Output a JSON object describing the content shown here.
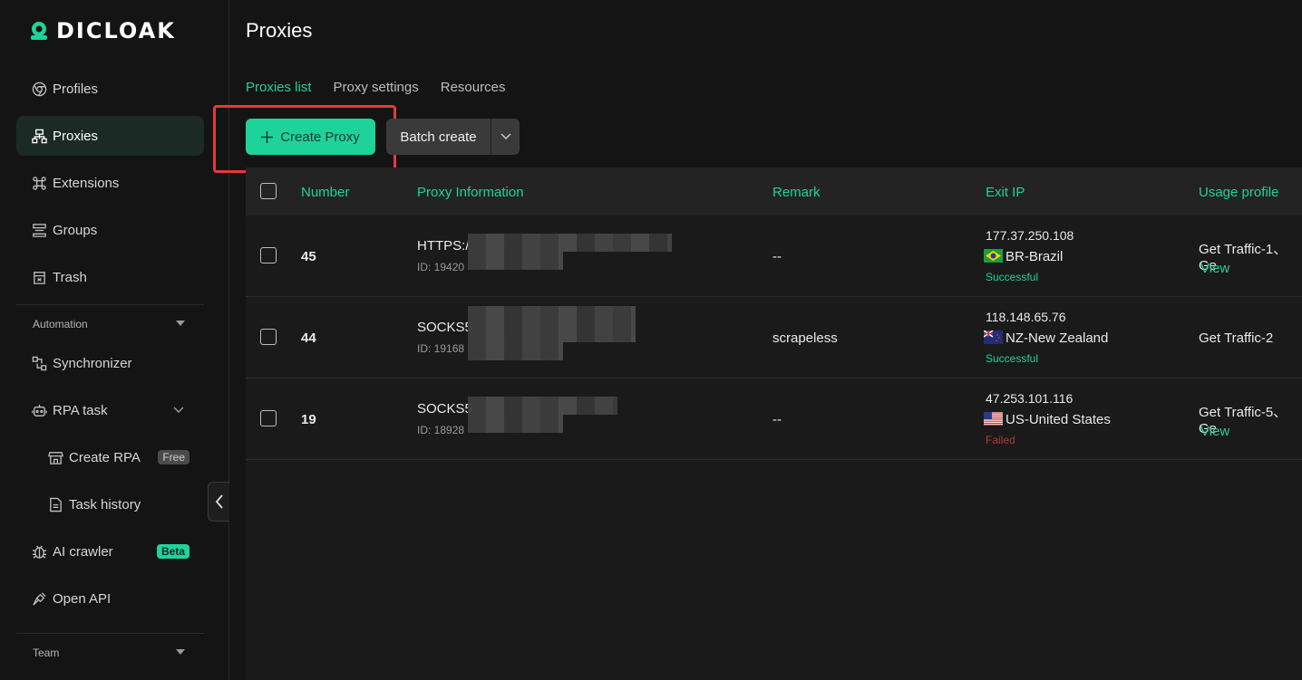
{
  "brand": {
    "name": "DICLOAK"
  },
  "sidebar": {
    "items": [
      {
        "label": "Profiles",
        "icon": "chrome-icon"
      },
      {
        "label": "Proxies",
        "icon": "network-icon"
      },
      {
        "label": "Extensions",
        "icon": "command-icon"
      },
      {
        "label": "Groups",
        "icon": "layers-icon"
      },
      {
        "label": "Trash",
        "icon": "trash-icon"
      }
    ],
    "automation_label": "Automation",
    "automation_items": [
      {
        "label": "Synchronizer",
        "icon": "sync-icon"
      },
      {
        "label": "RPA task",
        "icon": "robot-icon"
      },
      {
        "label": "Create RPA",
        "icon": "store-icon",
        "badge": "Free"
      },
      {
        "label": "Task history",
        "icon": "document-icon"
      },
      {
        "label": "AI crawler",
        "icon": "bug-icon",
        "badge": "Beta"
      },
      {
        "label": "Open API",
        "icon": "plug-icon"
      }
    ],
    "team_label": "Team"
  },
  "page": {
    "title": "Proxies",
    "tabs": [
      "Proxies list",
      "Proxy settings",
      "Resources"
    ],
    "create_button": "Create Proxy",
    "batch_button": "Batch create"
  },
  "table": {
    "headers": [
      "Number",
      "Proxy Information",
      "Remark",
      "Exit IP",
      "Usage profile"
    ],
    "rows": [
      {
        "number": "45",
        "proxy": "HTTPS:/",
        "id": "ID: 19420",
        "remark": "--",
        "ip": "177.37.250.108",
        "country": "BR-Brazil",
        "status": "Successful",
        "usage": "Get Traffic-1、Ge",
        "view": "View"
      },
      {
        "number": "44",
        "proxy": "SOCKS5",
        "id": "ID: 19168",
        "remark": "scrapeless",
        "ip": "118.148.65.76",
        "country": "NZ-New Zealand",
        "status": "Successful",
        "usage": "Get Traffic-2",
        "view": ""
      },
      {
        "number": "19",
        "proxy": "SOCKS5",
        "id": "ID: 18928",
        "remark": "--",
        "ip": "47.253.101.116",
        "country": "US-United States",
        "status": "Failed",
        "usage": "Get Traffic-5、Ge",
        "view": "View"
      }
    ]
  },
  "colors": {
    "accent": "#1ed39a",
    "highlight": "#e53b3b",
    "failed": "#b03a3a"
  }
}
